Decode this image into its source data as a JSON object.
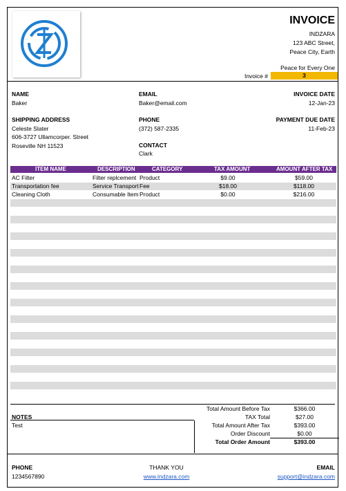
{
  "header": {
    "title": "INVOICE",
    "company": "INDZARA",
    "address_line1": "123 ABC Street,",
    "address_line2": "Peace City, Earth",
    "tagline": "Peace for Every One",
    "invoice_no_label": "Invoice #",
    "invoice_no": "3",
    "logo_colors": {
      "ring": "#1f7fd1",
      "mark": "#1f7fd1"
    }
  },
  "bill_to": {
    "name_label": "NAME",
    "name": "Baker",
    "email_label": "EMAIL",
    "email": "Baker@email.com",
    "invoice_date_label": "INVOICE DATE",
    "invoice_date": "12-Jan-23",
    "shipping_label": "SHIPPING ADDRESS",
    "shipping_line1": "Celeste Slater",
    "shipping_line2": "606-3727 Ullamcorper. Street",
    "shipping_line3": "Roseville NH 11523",
    "phone_label": "PHONE",
    "phone": "(372) 587-2335",
    "due_label": "PAYMENT DUE DATE",
    "due_date": "11-Feb-23",
    "contact_label": "CONTACT",
    "contact": "Clark"
  },
  "items": {
    "headers": [
      "ITEM NAME",
      "DESCRIPTION",
      "CATEGORY",
      "TAX AMOUNT",
      "AMOUNT AFTER TAX"
    ],
    "rows": [
      {
        "name": "AC Filter",
        "description": "Filter replcement",
        "category": "Product",
        "tax": "$9.00",
        "after_tax": "$59.00"
      },
      {
        "name": "Transportation fee",
        "description": "Service Transport",
        "category": "Fee",
        "tax": "$18.00",
        "after_tax": "$118.00"
      },
      {
        "name": "Cleaning Cloth",
        "description": "Consumable Item",
        "category": "Product",
        "tax": "$0.00",
        "after_tax": "$216.00"
      }
    ],
    "header_color": "#6a2e8e",
    "stripe_color": "#dcdcdc"
  },
  "totals": {
    "before_tax_label": "Total Amount Before Tax",
    "before_tax": "$366.00",
    "tax_label": "TAX Total",
    "tax": "$27.00",
    "after_tax_label": "Total Amount After Tax",
    "after_tax": "$393.00",
    "discount_label": "Order Discount",
    "discount": "$0.00",
    "total_label": "Total Order Amount",
    "total": "$393.00"
  },
  "notes": {
    "label": "NOTES",
    "text": "Test"
  },
  "footer": {
    "phone_label": "PHONE",
    "phone": "1234567890",
    "thanks": "THANK YOU",
    "website": "www.indzara.com",
    "email_label": "EMAIL",
    "email": "support@indzara.com"
  }
}
